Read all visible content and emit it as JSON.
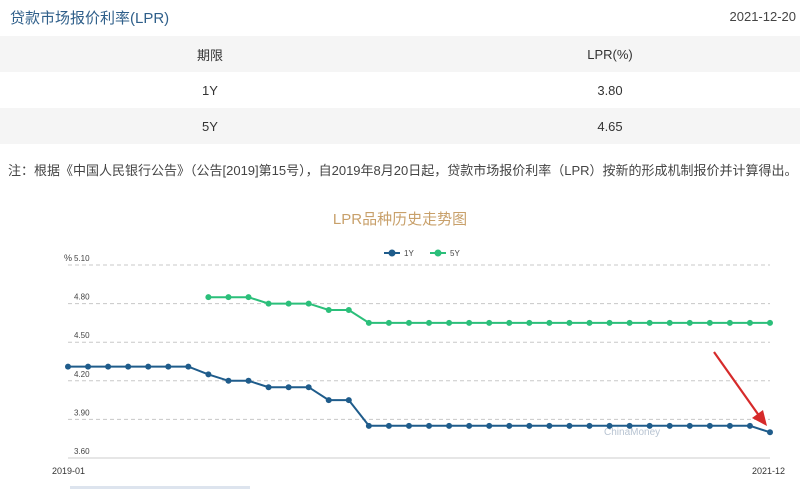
{
  "header": {
    "title": "贷款市场报价利率(LPR)",
    "date": "2021-12-20"
  },
  "table": {
    "headers": [
      "期限",
      "LPR(%)"
    ],
    "rows": [
      [
        "1Y",
        "3.80"
      ],
      [
        "5Y",
        "4.65"
      ]
    ]
  },
  "note": "注：根据《中国人民银行公告》（公告[2019]第15号），自2019年8月20日起，贷款市场报价利率（LPR）按新的形成机制报价并计算得出。",
  "colors": {
    "series_1y": "#1f5c8b",
    "series_5y": "#2bbf7a",
    "arrow": "#d62a2a",
    "title_color": "#c8a06a"
  },
  "chart_data": {
    "type": "line",
    "title": "LPR品种历史走势图",
    "ylabel": "%",
    "ylim": [
      3.6,
      5.1
    ],
    "yticks": [
      "5.10",
      "4.80",
      "4.50",
      "4.20",
      "3.90",
      "3.60"
    ],
    "x_start_label": "2019-01",
    "x_end_label": "2021-12",
    "watermark": "ChinaMoney",
    "grid": true,
    "legend": "top-center",
    "series": [
      {
        "name": "1Y",
        "values": [
          4.31,
          4.31,
          4.31,
          4.31,
          4.31,
          4.31,
          4.31,
          4.25,
          4.2,
          4.2,
          4.15,
          4.15,
          4.15,
          4.05,
          4.05,
          3.85,
          3.85,
          3.85,
          3.85,
          3.85,
          3.85,
          3.85,
          3.85,
          3.85,
          3.85,
          3.85,
          3.85,
          3.85,
          3.85,
          3.85,
          3.85,
          3.85,
          3.85,
          3.85,
          3.85,
          3.8
        ]
      },
      {
        "name": "5Y",
        "values": [
          null,
          null,
          null,
          null,
          null,
          null,
          null,
          4.85,
          4.85,
          4.85,
          4.8,
          4.8,
          4.8,
          4.75,
          4.75,
          4.65,
          4.65,
          4.65,
          4.65,
          4.65,
          4.65,
          4.65,
          4.65,
          4.65,
          4.65,
          4.65,
          4.65,
          4.65,
          4.65,
          4.65,
          4.65,
          4.65,
          4.65,
          4.65,
          4.65,
          4.65
        ]
      }
    ]
  }
}
